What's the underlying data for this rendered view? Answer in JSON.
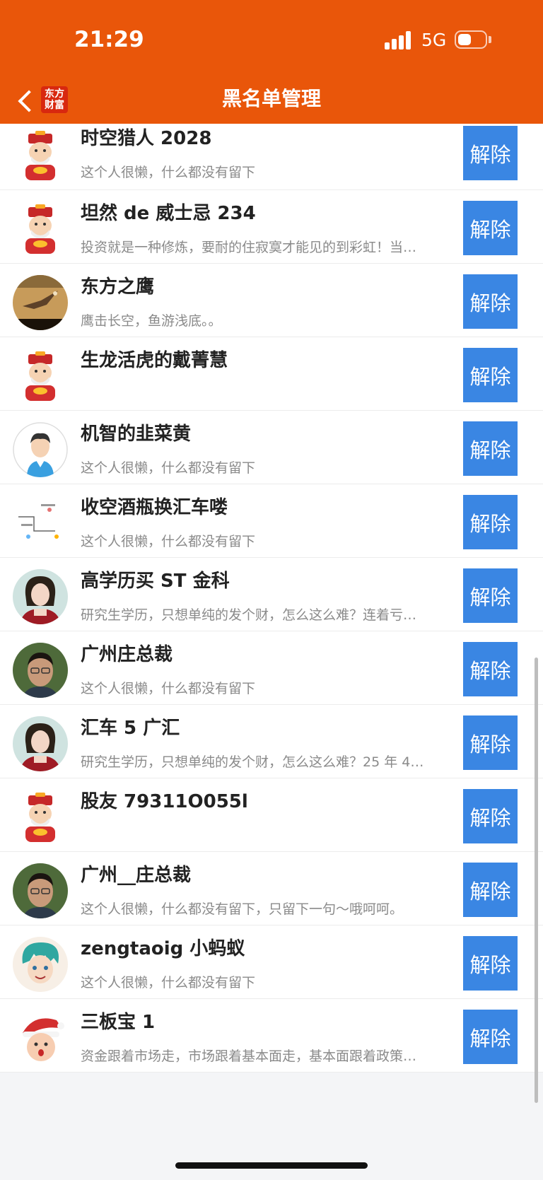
{
  "status_bar": {
    "time": "21:29",
    "network": "5G",
    "battery_percent": 35
  },
  "header": {
    "title": "黑名单管理",
    "brand_logo_line1": "东方",
    "brand_logo_line2": "财富"
  },
  "accent_color": "#e9560a",
  "button_color": "#3a86e3",
  "unblock_label": "解除",
  "list": [
    {
      "name": "时空猎人 2028",
      "desc": "这个人很懒，什么都没有留下",
      "avatar": "caishen-icon"
    },
    {
      "name": "坦然 de 威士忌 234",
      "desc": "投资就是一种修炼，要耐的住寂寞才能见的到彩虹！当…",
      "avatar": "caishen-icon"
    },
    {
      "name": "东方之鹰",
      "desc": "鹰击长空，鱼游浅底。。",
      "avatar": "eagle-photo"
    },
    {
      "name": "生龙活虎的戴菁慧",
      "desc": "",
      "avatar": "caishen-icon"
    },
    {
      "name": "机智的韭菜黄",
      "desc": "这个人很懒，什么都没有留下",
      "avatar": "default-user-icon"
    },
    {
      "name": "收空酒瓶换汇车喽",
      "desc": "这个人很懒，什么都没有留下",
      "avatar": "sketch-image"
    },
    {
      "name": "高学历买 ST 金科",
      "desc": "研究生学历，只想单纯的发个财，怎么这么难？连着亏…",
      "avatar": "woman-photo"
    },
    {
      "name": "广州庄总裁",
      "desc": "这个人很懒，什么都没有留下",
      "avatar": "man-photo"
    },
    {
      "name": "汇车 5 广汇",
      "desc": "研究生学历，只想单纯的发个财，怎么这么难？25 年 4…",
      "avatar": "woman-photo"
    },
    {
      "name": "股友 79311O055l",
      "desc": "",
      "avatar": "caishen-icon"
    },
    {
      "name": "广州__庄总裁",
      "desc": "这个人很懒，什么都没有留下，只留下一句～哦呵呵。",
      "avatar": "man-photo"
    },
    {
      "name": "zengtaoig 小蚂蚁",
      "desc": "这个人很懒，什么都没有留下",
      "avatar": "anime-boy-icon"
    },
    {
      "name": "三板宝 1",
      "desc": "资金跟着市场走，市场跟着基本面走，基本面跟着政策…",
      "avatar": "santa-baby-photo"
    }
  ]
}
